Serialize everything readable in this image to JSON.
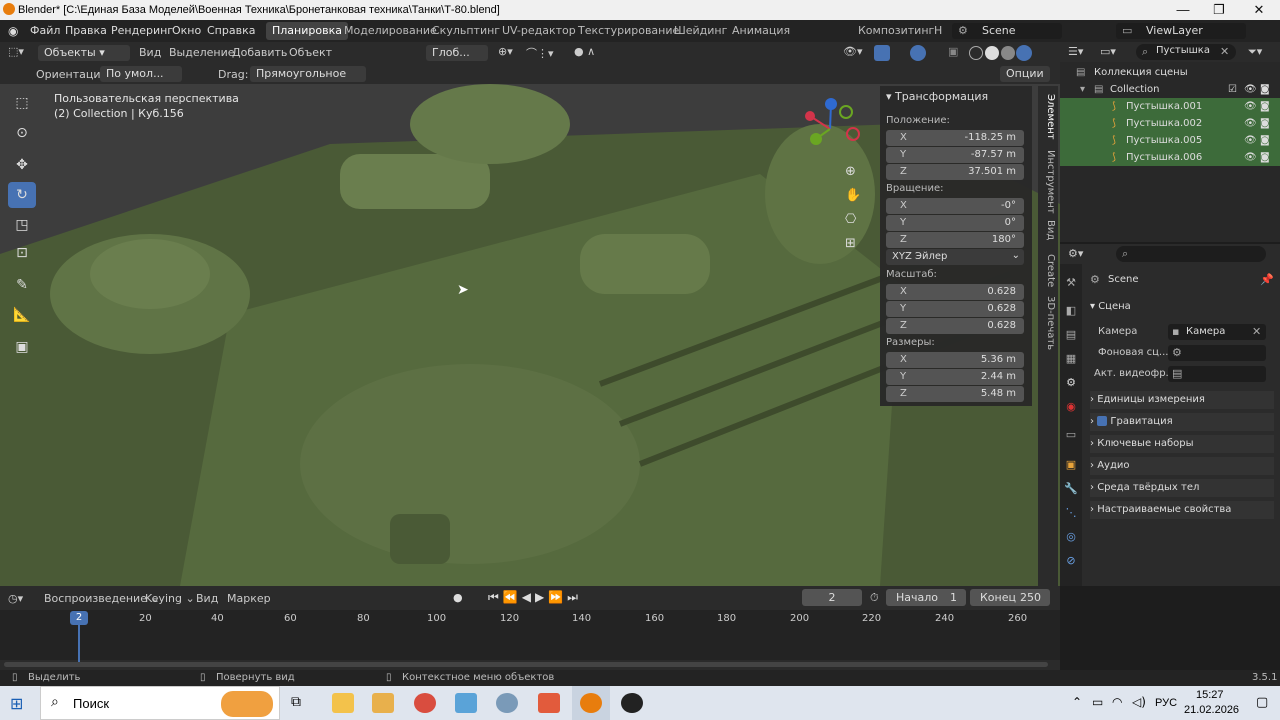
{
  "window": {
    "title": "Blender* [C:\\Единая База Моделей\\Военная Техника\\Бронетанковая техника\\Танки\\Т-80.blend]"
  },
  "menus": [
    "Файл",
    "Правка",
    "Рендеринг",
    "Окно",
    "Справка"
  ],
  "workspaces": [
    "Планировка",
    "Моделирование",
    "Скульптинг",
    "UV-редактор",
    "Текстурирование",
    "Шейдинг",
    "Анимация",
    "Композитинг",
    "Н"
  ],
  "scene": {
    "name": "Scene",
    "viewlayer": "ViewLayer"
  },
  "header": {
    "mode": "Объекты",
    "view": "Вид",
    "select": "Выделение",
    "add": "Добавить",
    "object": "Объект",
    "transform_space": "Глоб..."
  },
  "header2": {
    "orientation_label": "Ориентация:",
    "orientation_value": "По умол...",
    "drag_label": "Drag:",
    "drag_value": "Прямоугольное вы...",
    "options": "Опции"
  },
  "viewport": {
    "perspective": "Пользовательская перспектива",
    "collection_info": "(2) Collection | Куб.156"
  },
  "npanel": {
    "title": "Трансформация",
    "location_label": "Положение:",
    "location": [
      {
        "ax": "X",
        "v": "-118.25 m"
      },
      {
        "ax": "Y",
        "v": "-87.57 m"
      },
      {
        "ax": "Z",
        "v": "37.501 m"
      }
    ],
    "rotation_label": "Вращение:",
    "rotation": [
      {
        "ax": "X",
        "v": "-0°"
      },
      {
        "ax": "Y",
        "v": "0°"
      },
      {
        "ax": "Z",
        "v": "180°"
      }
    ],
    "rotation_mode": "XYZ Эйлер",
    "scale_label": "Масштаб:",
    "scale": [
      {
        "ax": "X",
        "v": "0.628"
      },
      {
        "ax": "Y",
        "v": "0.628"
      },
      {
        "ax": "Z",
        "v": "0.628"
      }
    ],
    "dimensions_label": "Размеры:",
    "dimensions": [
      {
        "ax": "X",
        "v": "5.36 m"
      },
      {
        "ax": "Y",
        "v": "2.44 m"
      },
      {
        "ax": "Z",
        "v": "5.48 m"
      }
    ]
  },
  "ntabs": [
    "Элемент",
    "Инструмент",
    "Вид",
    "Create",
    "3D-печать"
  ],
  "outliner": {
    "search": "Пустышка",
    "scene_collection": "Коллекция сцены",
    "collection": "Collection",
    "items": [
      "Пустышка.001",
      "Пустышка.002",
      "Пустышка.005",
      "Пустышка.006"
    ]
  },
  "properties": {
    "scene_name": "Scene",
    "section": "Сцена",
    "camera_label": "Камера",
    "camera_value": "Камера",
    "bg_label": "Фоновая сц...",
    "clip_label": "Акт. видеофр.",
    "panels": [
      "Единицы измерения",
      "Гравитация",
      "Ключевые наборы",
      "Аудио",
      "Среда твёрдых тел",
      "Настраиваемые свойства"
    ]
  },
  "timeline": {
    "playback": "Воспроизведение",
    "keying": "Keying",
    "view": "Вид",
    "marker": "Маркер",
    "current_frame": "2",
    "start_label": "Начало",
    "start": "1",
    "end_label": "Конец",
    "end": "250",
    "ticks": [
      "2",
      "20",
      "40",
      "60",
      "80",
      "100",
      "120",
      "140",
      "160",
      "180",
      "200",
      "220",
      "240",
      "260"
    ]
  },
  "status": {
    "select": "Выделить",
    "rotate": "Повернуть вид",
    "context": "Контекстное меню объектов",
    "version": "3.5.1"
  },
  "taskbar": {
    "search": "Поиск",
    "lang": "РУС",
    "time": "15:27",
    "date": "21.02.2026"
  }
}
